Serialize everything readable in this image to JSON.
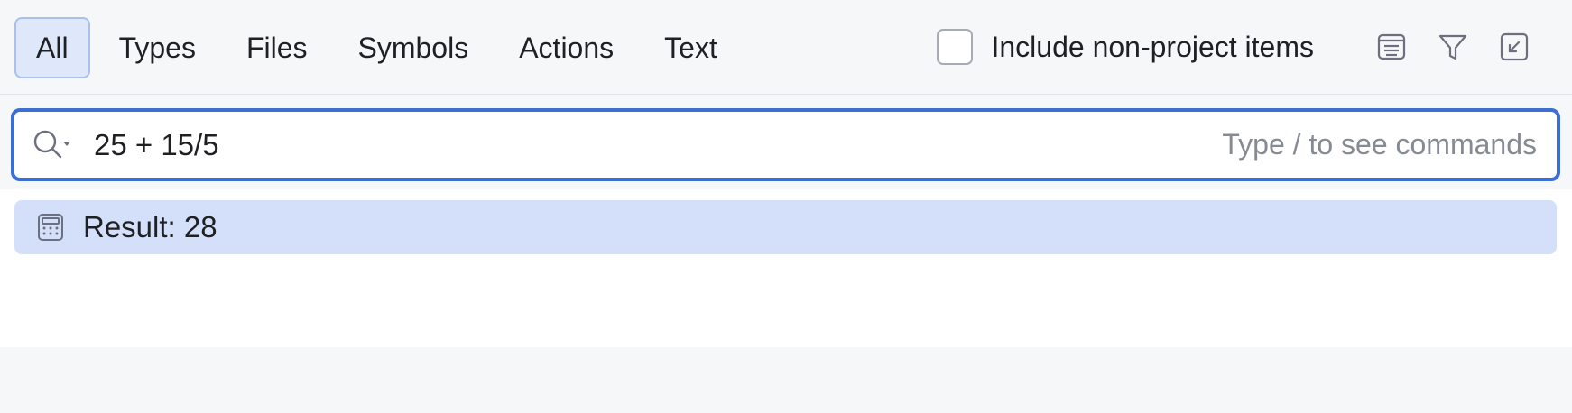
{
  "tabs": [
    {
      "label": "All",
      "active": true
    },
    {
      "label": "Types"
    },
    {
      "label": "Files"
    },
    {
      "label": "Symbols"
    },
    {
      "label": "Actions"
    },
    {
      "label": "Text"
    }
  ],
  "options": {
    "include_non_project_label": "Include non-project items",
    "include_non_project_checked": false,
    "icons": [
      "preview-icon",
      "filter-icon",
      "collapse-icon"
    ]
  },
  "search": {
    "value": "25 + 15/5",
    "hint": "Type / to see commands",
    "icon": "search-icon"
  },
  "results": [
    {
      "icon": "calculator-icon",
      "text": "Result: 28",
      "selected": true
    }
  ],
  "colors": {
    "accent": "#3d6fd3",
    "selection": "#d4e0fa",
    "active_tab_bg": "#dfe8fb"
  }
}
